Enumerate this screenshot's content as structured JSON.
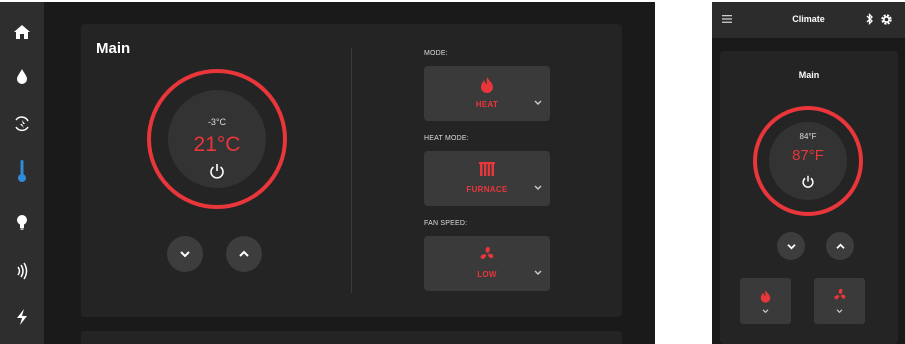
{
  "tablet": {
    "sidebar": {
      "items": [
        {
          "icon": "home-icon"
        },
        {
          "icon": "water-drop-icon"
        },
        {
          "icon": "fan-mode-icon"
        },
        {
          "icon": "thermometer-icon",
          "active": true
        },
        {
          "icon": "lightbulb-icon"
        },
        {
          "icon": "audio-waves-icon"
        },
        {
          "icon": "lightning-icon"
        }
      ]
    },
    "zone": {
      "title": "Main",
      "current_temp": "-3°C",
      "setpoint": "21°C"
    },
    "controls": {
      "mode": {
        "label": "MODE:",
        "value": "HEAT",
        "icon": "flame-icon"
      },
      "heat_mode": {
        "label": "HEAT MODE:",
        "value": "FURNACE",
        "icon": "furnace-icon"
      },
      "fan_speed": {
        "label": "FAN SPEED:",
        "value": "LOW",
        "icon": "fan-icon"
      }
    }
  },
  "phone": {
    "header": {
      "title": "Climate"
    },
    "zone": {
      "title": "Main",
      "current_temp": "84°F",
      "setpoint": "87°F"
    }
  },
  "colors": {
    "accent": "#e8363b",
    "background": "#1a1a1a",
    "card": "#242424",
    "sidebar": "#2e2e2e",
    "button": "#3a3a3a",
    "active_icon": "#2f8ad8"
  }
}
